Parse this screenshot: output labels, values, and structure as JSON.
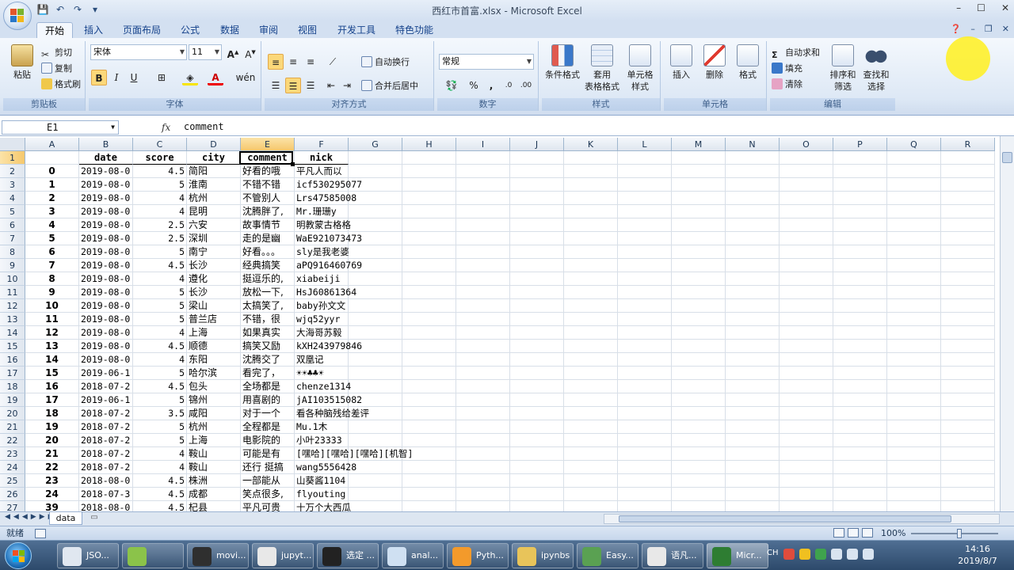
{
  "window": {
    "title": "西红市首富.xlsx - Microsoft Excel",
    "controls": [
      "–",
      "☐",
      "✕"
    ]
  },
  "tabs": [
    "开始",
    "插入",
    "页面布局",
    "公式",
    "数据",
    "审阅",
    "视图",
    "开发工具",
    "特色功能"
  ],
  "ribbon": {
    "clipboard": {
      "paste": "粘贴",
      "cut": "剪切",
      "copy": "复制",
      "format_painter": "格式刷",
      "label": "剪贴板"
    },
    "font": {
      "name": "宋体",
      "size": "11",
      "bold": "B",
      "italic": "I",
      "underline": "U",
      "label": "字体"
    },
    "alignment": {
      "wrap": "自动换行",
      "merge": "合并后居中",
      "label": "对齐方式"
    },
    "number": {
      "format": "常规",
      "percent": "%",
      "comma": ",",
      "label": "数字"
    },
    "styles": {
      "conditional": "条件格式",
      "table": "套用\n表格格式",
      "cell_style": "单元格\n样式",
      "label": "样式"
    },
    "cells": {
      "insert": "插入",
      "delete": "删除",
      "format": "格式",
      "label": "单元格"
    },
    "editing": {
      "autosum": "自动求和",
      "fill": "填充",
      "clear": "清除",
      "sort": "排序和\n筛选",
      "find": "查找和\n选择",
      "label": "编辑"
    }
  },
  "formula_bar": {
    "name_box": "E1",
    "fx": "fx",
    "content": "comment"
  },
  "columns": [
    "A",
    "B",
    "C",
    "D",
    "E",
    "F",
    "G",
    "H",
    "I",
    "J",
    "K",
    "L",
    "M",
    "N",
    "O",
    "P",
    "Q",
    "R"
  ],
  "header_row": {
    "row": "1",
    "a": "",
    "b": "date",
    "c": "score",
    "d": "city",
    "e": "comment",
    "f": "nick"
  },
  "rows": [
    {
      "row": "2",
      "a": "0",
      "b": "2019-08-0",
      "c": "4.5",
      "d": "简阳",
      "e": "好看的哦",
      "f": "平凡人而以"
    },
    {
      "row": "3",
      "a": "1",
      "b": "2019-08-0",
      "c": "5",
      "d": "淮南",
      "e": "不错不错",
      "f": "icf530295077"
    },
    {
      "row": "4",
      "a": "2",
      "b": "2019-08-0",
      "c": "4",
      "d": "杭州",
      "e": "不管别人",
      "f": "Lrs47585008"
    },
    {
      "row": "5",
      "a": "3",
      "b": "2019-08-0",
      "c": "4",
      "d": "昆明",
      "e": "沈腾胖了,",
      "f": "Mr.珊珊y"
    },
    {
      "row": "6",
      "a": "4",
      "b": "2019-08-0",
      "c": "2.5",
      "d": "六安",
      "e": "故事情节",
      "f": "明教蒙古格格"
    },
    {
      "row": "7",
      "a": "5",
      "b": "2019-08-0",
      "c": "2.5",
      "d": "深圳",
      "e": "走的是幽",
      "f": "WaE921073473"
    },
    {
      "row": "8",
      "a": "6",
      "b": "2019-08-0",
      "c": "5",
      "d": "南宁",
      "e": "好看。。。",
      "f": "sly是我老婆"
    },
    {
      "row": "9",
      "a": "7",
      "b": "2019-08-0",
      "c": "4.5",
      "d": "长沙",
      "e": "经典搞笑",
      "f": "aPQ916460769"
    },
    {
      "row": "10",
      "a": "8",
      "b": "2019-08-0",
      "c": "4",
      "d": "遵化",
      "e": "挺逗乐的,",
      "f": "xiabeiji"
    },
    {
      "row": "11",
      "a": "9",
      "b": "2019-08-0",
      "c": "5",
      "d": "长沙",
      "e": "放松一下,",
      "f": "HsJ60861364"
    },
    {
      "row": "12",
      "a": "10",
      "b": "2019-08-0",
      "c": "5",
      "d": "梁山",
      "e": "太搞笑了,",
      "f": "baby孙文文"
    },
    {
      "row": "13",
      "a": "11",
      "b": "2019-08-0",
      "c": "5",
      "d": "普兰店",
      "e": "不错，很",
      "f": "wjq52yyr"
    },
    {
      "row": "14",
      "a": "12",
      "b": "2019-08-0",
      "c": "4",
      "d": "上海",
      "e": "如果真实",
      "f": "大海哥苏毅"
    },
    {
      "row": "15",
      "a": "13",
      "b": "2019-08-0",
      "c": "4.5",
      "d": "顺德",
      "e": "搞笑又励",
      "f": "kXH243979846"
    },
    {
      "row": "16",
      "a": "14",
      "b": "2019-08-0",
      "c": "4",
      "d": "东阳",
      "e": "沈腾交了",
      "f": "双凰记"
    },
    {
      "row": "17",
      "a": "15",
      "b": "2019-06-1",
      "c": "5",
      "d": "哈尔滨",
      "e": "看完了，",
      "f": "☀☀♣♣☀"
    },
    {
      "row": "18",
      "a": "16",
      "b": "2018-07-2",
      "c": "4.5",
      "d": "包头",
      "e": "全场都是",
      "f": "chenze1314"
    },
    {
      "row": "19",
      "a": "17",
      "b": "2019-06-1",
      "c": "5",
      "d": "锦州",
      "e": "用喜剧的",
      "f": "jAI103515082"
    },
    {
      "row": "20",
      "a": "18",
      "b": "2018-07-2",
      "c": "3.5",
      "d": "咸阳",
      "e": "对于一个",
      "f": "看各种脑残给差评"
    },
    {
      "row": "21",
      "a": "19",
      "b": "2018-07-2",
      "c": "5",
      "d": "杭州",
      "e": "全程都是",
      "f": "Mu.1木"
    },
    {
      "row": "22",
      "a": "20",
      "b": "2018-07-2",
      "c": "5",
      "d": "上海",
      "e": "电影院的",
      "f": "小叶23333"
    },
    {
      "row": "23",
      "a": "21",
      "b": "2018-07-2",
      "c": "4",
      "d": "鞍山",
      "e": "可能是有",
      "f": "[嘿哈][嘿哈][嘿哈][机智]"
    },
    {
      "row": "24",
      "a": "22",
      "b": "2018-07-2",
      "c": "4",
      "d": "鞍山",
      "e": "还行 挺搞",
      "f": "wang5556428"
    },
    {
      "row": "25",
      "a": "23",
      "b": "2018-08-0",
      "c": "4.5",
      "d": "株洲",
      "e": "一部能从",
      "f": "山葵酱1104"
    },
    {
      "row": "26",
      "a": "24",
      "b": "2018-07-3",
      "c": "4.5",
      "d": "成都",
      "e": "笑点很多,",
      "f": "flyouting"
    },
    {
      "row": "27",
      "a": "39",
      "b": "2018-08-0",
      "c": "4.5",
      "d": "杞县",
      "e": "平凡可贵",
      "f": "十万个大西瓜"
    }
  ],
  "sheet_tab": "data",
  "status": {
    "ready": "就绪",
    "zoom": "100%"
  },
  "taskbar": {
    "items": [
      "JSO...",
      "",
      "movi...",
      "jupyt...",
      "选定 ...",
      "anal...",
      "Pyth...",
      "ipynbs",
      "Easy...",
      "语凡...",
      "Micr..."
    ],
    "clock_time": "14:16",
    "clock_date": "2019/8/7",
    "tray_text": "CH"
  }
}
